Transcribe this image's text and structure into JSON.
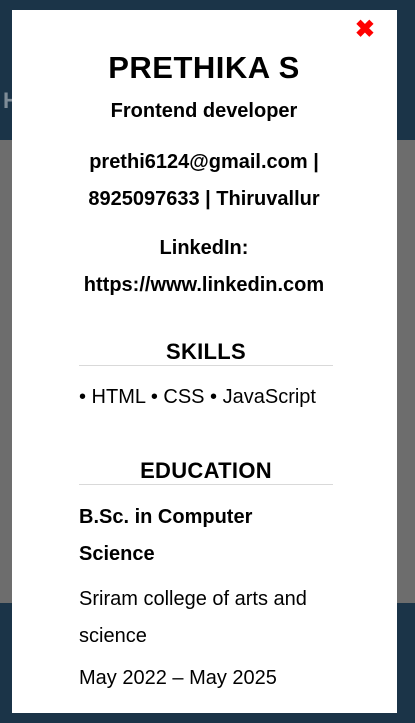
{
  "background": {
    "partial_letter": "H"
  },
  "modal": {
    "close_icon": "✖",
    "name": "PRETHIKA S",
    "role": "Frontend developer",
    "contact": "prethi6124@gmail.com | 8925097633 | Thiruvallur",
    "linkedin_label": "LinkedIn:",
    "linkedin_url": "https://www.linkedin.com"
  },
  "skills": {
    "title": "SKILLS",
    "list": "• HTML • CSS • JavaScript"
  },
  "education": {
    "title": "EDUCATION",
    "degree": "B.Sc. in Computer Science",
    "college": "Sriram college of arts and science",
    "dates": "May 2022 – May 2025"
  },
  "colors": {
    "backdrop_dark": "#1b3448",
    "overlay_gray": "#6d6d6d",
    "close_red": "#ff0000"
  }
}
